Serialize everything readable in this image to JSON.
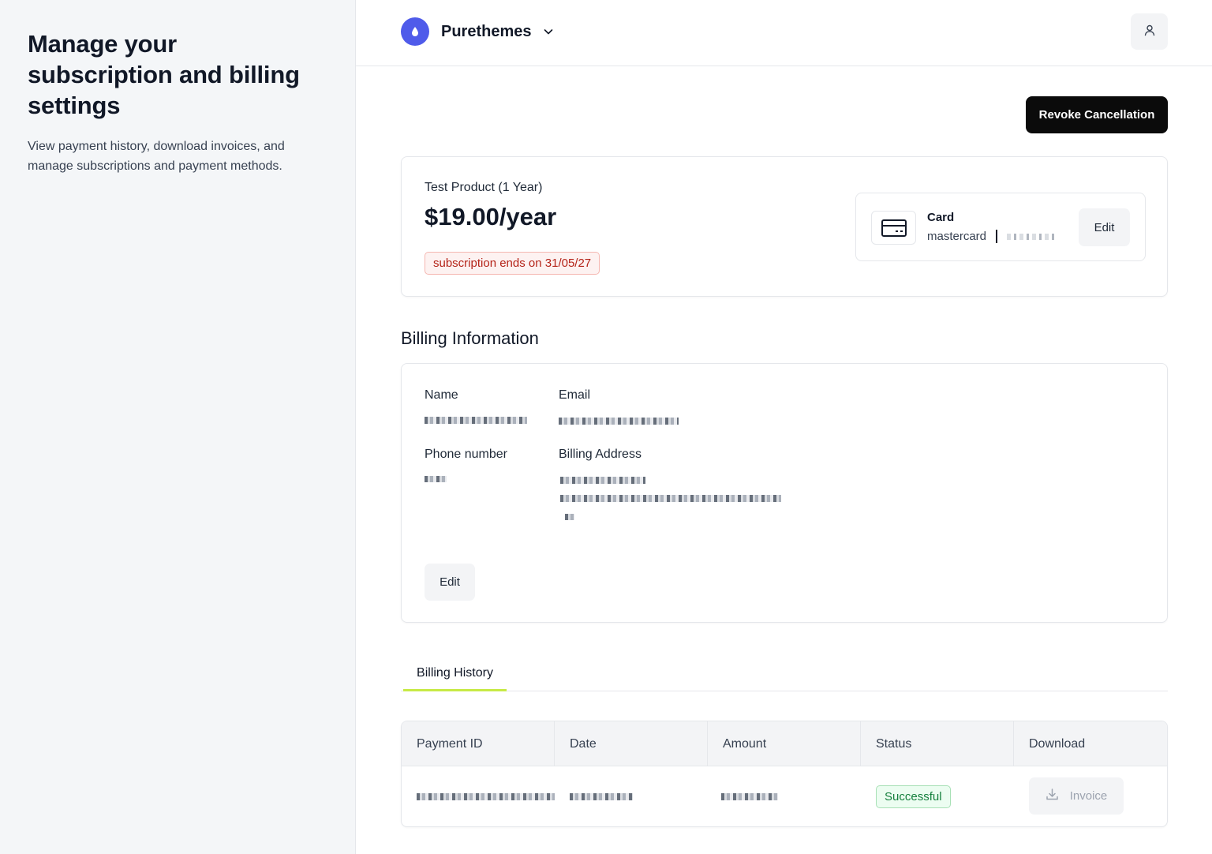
{
  "sidebar": {
    "title": "Manage your subscription and billing settings",
    "description": "View payment history, download invoices, and manage subscriptions and payment methods."
  },
  "header": {
    "brand_name": "Purethemes",
    "brand_icon": "drop-icon",
    "brand_color": "#4f5bea",
    "user_icon": "user-icon"
  },
  "actions": {
    "revoke_label": "Revoke Cancellation"
  },
  "subscription": {
    "product": "Test Product (1 Year)",
    "price": "$19.00/year",
    "status_badge": "subscription ends on 31/05/27",
    "payment_method": {
      "title": "Card",
      "brand": "mastercard",
      "edit_label": "Edit"
    }
  },
  "billing_info": {
    "section_title": "Billing Information",
    "name_label": "Name",
    "email_label": "Email",
    "phone_label": "Phone number",
    "address_label": "Billing Address",
    "edit_label": "Edit"
  },
  "billing_history": {
    "tab_label": "Billing History",
    "columns": [
      "Payment ID",
      "Date",
      "Amount",
      "Status",
      "Download"
    ],
    "rows": [
      {
        "status": "Successful",
        "download_label": "Invoice"
      }
    ]
  },
  "colors": {
    "accent_tab": "#c7ea46",
    "danger": "#b42318",
    "success": "#15803d"
  }
}
